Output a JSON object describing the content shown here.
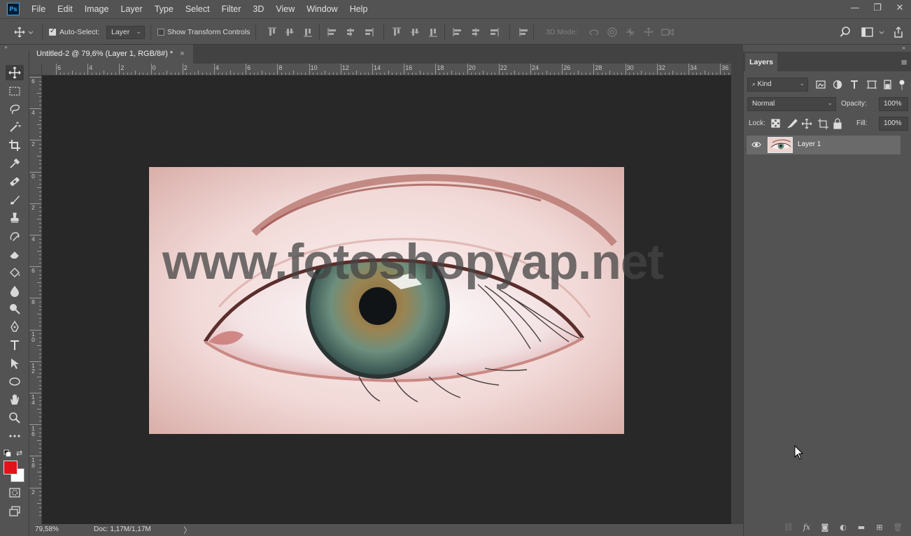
{
  "app": {
    "logo_text": "Ps"
  },
  "menu": [
    "File",
    "Edit",
    "Image",
    "Layer",
    "Type",
    "Select",
    "Filter",
    "3D",
    "View",
    "Window",
    "Help"
  ],
  "window_controls": {
    "minimize": "—",
    "restore": "❐",
    "close": "✕"
  },
  "options_bar": {
    "auto_select_label": "Auto-Select:",
    "auto_select_checked": true,
    "auto_select_target": "Layer",
    "show_transform_label": "Show Transform Controls",
    "show_transform_checked": false,
    "mode_label": "3D Mode:"
  },
  "document": {
    "tab_title": "Untitled-2 @ 79,6% (Layer 1, RGB/8#) *",
    "close_glyph": "×",
    "ruler_h_labels": [
      "6",
      "4",
      "2",
      "0",
      "2",
      "4",
      "6",
      "8",
      "10",
      "12",
      "14",
      "16",
      "18",
      "20",
      "22",
      "24",
      "26",
      "28",
      "30",
      "32",
      "34",
      "36"
    ],
    "ruler_v_labels": [
      "6",
      "4",
      "2",
      "0",
      "2",
      "4",
      "6",
      "8",
      "10",
      "12",
      "14",
      "16",
      "18",
      "2"
    ],
    "watermark_text": "www.fotoshopyap.net"
  },
  "status_bar": {
    "zoom": "79,58%",
    "doc_info": "Doc: 1,17M/1,17M",
    "arrow": "〉"
  },
  "layers_panel": {
    "tab_label": "Layers",
    "menu_glyph": "≡",
    "filter_label": "Kind",
    "blend_mode": "Normal",
    "opacity_label": "Opacity:",
    "opacity_value": "100%",
    "lock_label": "Lock:",
    "fill_label": "Fill:",
    "fill_value": "100%",
    "layers": [
      {
        "name": "Layer 1",
        "visible": true
      }
    ]
  },
  "colors": {
    "foreground": "#e0141a",
    "background": "#ffffff",
    "chrome": "#535353",
    "pasteboard": "#282828"
  }
}
